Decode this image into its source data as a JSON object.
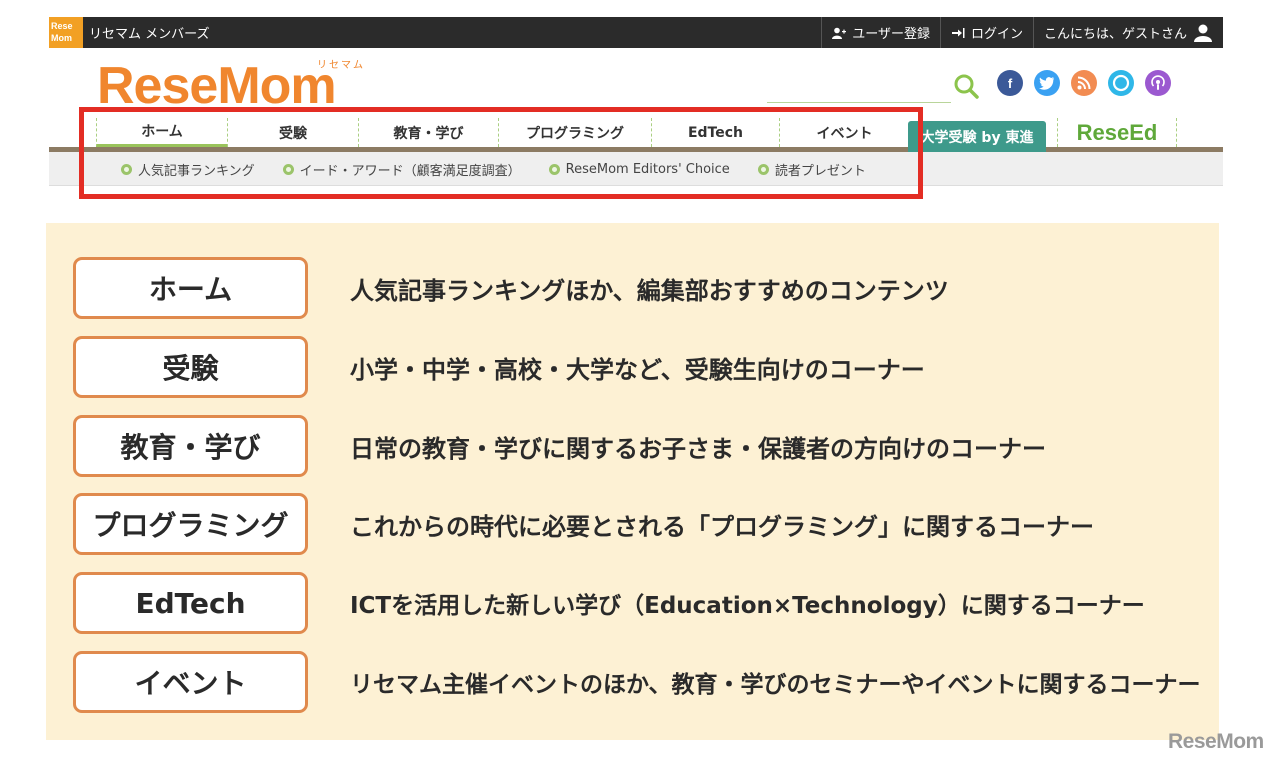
{
  "topbar": {
    "logo_text": "Rese Mom",
    "site_name": "リセマム メンバーズ",
    "register": "ユーザー登録",
    "login": "ログイン",
    "greeting": "こんにちは、ゲストさん"
  },
  "header": {
    "logo": "ReseMom",
    "logo_sub": "リセマム",
    "social_icons": [
      "facebook-icon",
      "twitter-icon",
      "rss-icon",
      "alexa-icon",
      "podcast-icon"
    ],
    "colors": {
      "facebook": "#3b5998",
      "twitter": "#3aa1f2",
      "rss": "#f28c52",
      "alexa": "#2fb7e8",
      "podcast": "#9b59d0",
      "accent": "#f0862e",
      "nav_badge": "#3e9a8b",
      "highlight": "#e32d24"
    }
  },
  "nav": {
    "items": [
      "ホーム",
      "受験",
      "教育・学び",
      "プログラミング",
      "EdTech",
      "イベント"
    ],
    "badge": "大学受験 by 東進",
    "reseed": "ReseEd"
  },
  "subnav": {
    "items": [
      "人気記事ランキング",
      "イード・アワード（顧客満足度調査）",
      "ReseMom Editors' Choice",
      "読者プレゼント"
    ]
  },
  "panel": {
    "rows": [
      {
        "label": "ホーム",
        "desc": "人気記事ランキングほか、編集部おすすめのコンテンツ"
      },
      {
        "label": "受験",
        "desc": "小学・中学・高校・大学など、受験生向けのコーナー"
      },
      {
        "label": "教育・学び",
        "desc": "日常の教育・学びに関するお子さま・保護者の方向けのコーナー"
      },
      {
        "label": "プログラミング",
        "desc": "これからの時代に必要とされる「プログラミング」に関するコーナー"
      },
      {
        "label": "EdTech",
        "desc": "ICTを活用した新しい学び（Education×Technology）に関するコーナー"
      },
      {
        "label": "イベント",
        "desc": "リセマム主催イベントのほか、教育・学びのセミナーやイベントに関するコーナー"
      }
    ]
  },
  "watermark": "ReseMom"
}
